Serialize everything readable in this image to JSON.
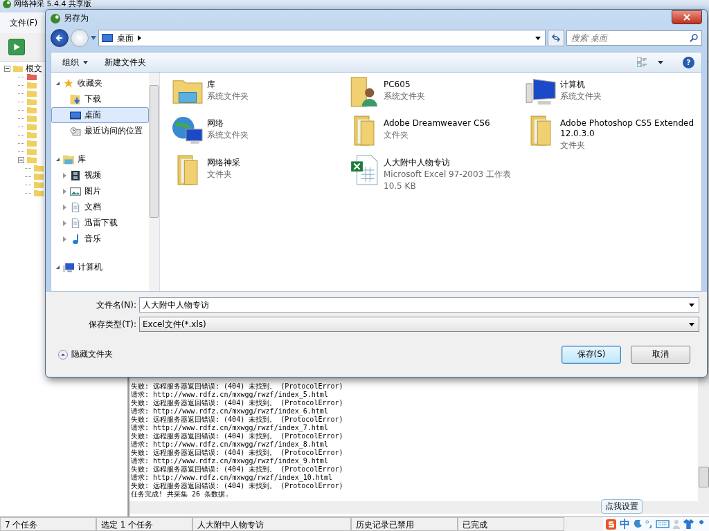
{
  "app": {
    "title": "网络神采 5.4.4 共享版",
    "menu": [
      "文件(F)"
    ],
    "tree": {
      "root": "根文",
      "expanded": true,
      "children": [
        {
          "color": "#e06060"
        },
        {
          "color": "#f0d060"
        },
        {
          "color": "#f0d060"
        },
        {
          "color": "#f0d060"
        },
        {
          "color": "#f0d060"
        },
        {
          "color": "#f0d060"
        },
        {
          "color": "#f0d060"
        },
        {
          "color": "#f0d060"
        },
        {
          "color": "#f0d060"
        },
        {
          "color": "#f0d060"
        },
        {
          "color": "#f0d060",
          "expanded": true,
          "children": [
            {
              "color": "#f0d060"
            },
            {
              "color": "#f0d060"
            },
            {
              "color": "#f0d060"
            },
            {
              "color": "#f0d060"
            }
          ]
        }
      ]
    },
    "log": [
      "失败: 远程服务器返回错误: (404) 未找到。 (ProtocolError)",
      "请求: http://www.rdfz.cn/mxwgg/rwzf/index_5.html",
      "失败: 远程服务器返回错误: (404) 未找到。 (ProtocolError)",
      "请求: http://www.rdfz.cn/mxwgg/rwzf/index_6.html",
      "失败: 远程服务器返回错误: (404) 未找到。 (ProtocolError)",
      "请求: http://www.rdfz.cn/mxwgg/rwzf/index_7.html",
      "失败: 远程服务器返回错误: (404) 未找到。 (ProtocolError)",
      "请求: http://www.rdfz.cn/mxwgg/rwzf/index_8.html",
      "失败: 远程服务器返回错误: (404) 未找到。 (ProtocolError)",
      "请求: http://www.rdfz.cn/mxwgg/rwzf/index_9.html",
      "失败: 远程服务器返回错误: (404) 未找到。 (ProtocolError)",
      "请求: http://www.rdfz.cn/mxwgg/rwzf/index_10.html",
      "失败: 远程服务器返回错误: (404) 未找到。 (ProtocolError)",
      "任务完成! 共采集 26 条数据."
    ],
    "status_bar": [
      "7 个任务",
      "选定 1 个任务",
      "人大附中人物专访",
      "历史记录已禁用",
      "已完成"
    ],
    "ime": {
      "mode": "中",
      "tooltip": "点我设置"
    }
  },
  "dialog": {
    "title": "另存为",
    "address": "桌面",
    "search": {
      "placeholder": "搜索 桌面"
    },
    "toolbar": [
      {
        "label": "组织",
        "dropdown": true
      },
      {
        "label": "新建文件夹",
        "dropdown": false
      }
    ],
    "help": "?",
    "nav": [
      {
        "label": "收藏夹",
        "kind": "star",
        "expanded": true,
        "selected": false,
        "children": [
          {
            "label": "下载",
            "kind": "download",
            "selected": false
          },
          {
            "label": "桌面",
            "kind": "desktop",
            "selected": true
          },
          {
            "label": "最近访问的位置",
            "kind": "recent",
            "selected": false
          }
        ]
      },
      {
        "label": "库",
        "kind": "library",
        "expanded": true,
        "selected": false,
        "children": [
          {
            "label": "视频",
            "kind": "video",
            "selected": false,
            "expanded": false
          },
          {
            "label": "图片",
            "kind": "picture",
            "selected": false,
            "expanded": false
          },
          {
            "label": "文档",
            "kind": "document",
            "selected": false,
            "expanded": false
          },
          {
            "label": "迅雷下载",
            "kind": "document",
            "selected": false,
            "expanded": false
          },
          {
            "label": "音乐",
            "kind": "music",
            "selected": false,
            "expanded": false
          }
        ]
      },
      {
        "label": "计算机",
        "kind": "computer",
        "expanded": true,
        "selected": false
      }
    ],
    "items": [
      {
        "name": "库",
        "kind": "library",
        "type": "系统文件夹"
      },
      {
        "name": "PC605",
        "kind": "user",
        "type": "系统文件夹"
      },
      {
        "name": "计算机",
        "kind": "computer",
        "type": "系统文件夹"
      },
      {
        "name": "网络",
        "kind": "network",
        "type": "系统文件夹"
      },
      {
        "name": "Adobe Dreamweaver CS6",
        "kind": "folder",
        "type": "文件夹"
      },
      {
        "name": "Adobe Photoshop CS5 Extended 12.0.3.0",
        "kind": "folder",
        "type": "文件夹"
      },
      {
        "name": "网络神采",
        "kind": "folder",
        "type": "文件夹"
      },
      {
        "name": "人大附中人物专访",
        "kind": "excel",
        "type": "Microsoft Excel 97-2003 工作表",
        "size": "10.5 KB"
      }
    ],
    "filename_label": "文件名(N):",
    "filename": "人大附中人物专访",
    "filetype_label": "保存类型(T):",
    "filetype": "Excel文件(*.xls)",
    "hide_folders": "隐藏文件夹",
    "buttons": [
      {
        "label": "保存(S)",
        "default": true
      },
      {
        "label": "取消",
        "default": false
      }
    ]
  }
}
